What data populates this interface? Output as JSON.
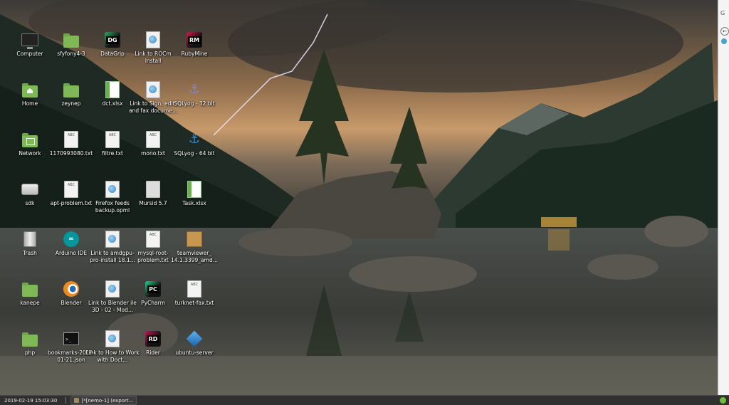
{
  "desktop": {
    "icons": [
      {
        "label": "Computer",
        "type": "monitor"
      },
      {
        "label": "sfyfony4-3",
        "type": "folder"
      },
      {
        "label": "DataGrip",
        "type": "jetbrains",
        "badge": "DG",
        "color": "#21b05c"
      },
      {
        "label": "Link to ROCm Install",
        "type": "link"
      },
      {
        "label": "RubyMine",
        "type": "jetbrains",
        "badge": "RM",
        "color": "#e0144f"
      },
      {
        "label": "Home",
        "type": "folder-home"
      },
      {
        "label": "zeynep",
        "type": "folder"
      },
      {
        "label": "dct.xlsx",
        "type": "sheet"
      },
      {
        "label": "Link to Sign, edit, and fax docume...",
        "type": "link"
      },
      {
        "label": "SQLyog - 32 bit",
        "type": "dolphin",
        "color": "#8a7fd8"
      },
      {
        "label": "Network",
        "type": "folder-network"
      },
      {
        "label": "1170993080.txt",
        "type": "doc"
      },
      {
        "label": "filtre.txt",
        "type": "doc"
      },
      {
        "label": "mono.txt",
        "type": "doc"
      },
      {
        "label": "SQLyog - 64 bit",
        "type": "dolphin",
        "color": "#2b8fd8"
      },
      {
        "label": "sdk",
        "type": "drive"
      },
      {
        "label": "apt-problem.txt",
        "type": "doc"
      },
      {
        "label": "Firefox feeds backup.opml",
        "type": "link"
      },
      {
        "label": "Mursid 5.7",
        "type": "doc-gray"
      },
      {
        "label": "Task.xlsx",
        "type": "sheet"
      },
      {
        "label": "Trash",
        "type": "trash"
      },
      {
        "label": "Arduino IDE",
        "type": "arduino"
      },
      {
        "label": "Link to amdgpu-pro-install 18.1...",
        "type": "link"
      },
      {
        "label": "mysql-root-problem.txt",
        "type": "doc"
      },
      {
        "label": "teamviewer_ 14.1.3399_amd...",
        "type": "package"
      },
      {
        "label": "kanepe",
        "type": "folder"
      },
      {
        "label": "Blender",
        "type": "blender"
      },
      {
        "label": "Link to Blender ile 3D - 02 - Mod...",
        "type": "link"
      },
      {
        "label": "PyCharm",
        "type": "jetbrains",
        "badge": "PC",
        "color": "#21d789"
      },
      {
        "label": "turknet-fax.txt",
        "type": "doc"
      },
      {
        "label": "php",
        "type": "folder"
      },
      {
        "label": "bookmarks-2019-01-21.json",
        "type": "terminal"
      },
      {
        "label": "Link to How to Work with Doct...",
        "type": "link"
      },
      {
        "label": "Rider",
        "type": "jetbrains",
        "badge": "RD",
        "color": "#c90f5e"
      },
      {
        "label": "ubuntu-server",
        "type": "vbox"
      }
    ]
  },
  "taskbar": {
    "clock": "2019-02-19 15:03:30",
    "window_title": "[*[nemo-1] (export..."
  },
  "browser_edge": {
    "letter": "G",
    "back_arrow": "←"
  }
}
